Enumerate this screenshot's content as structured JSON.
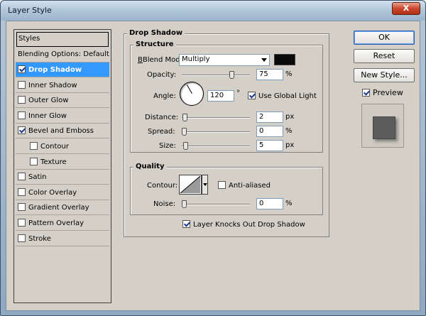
{
  "window": {
    "title": "Layer Style",
    "close": "X"
  },
  "styles": {
    "header": "Styles",
    "blending": "Blending Options: Default",
    "items": [
      {
        "label": "Drop Shadow",
        "checked": true,
        "selected": true,
        "sub": false
      },
      {
        "label": "Inner Shadow",
        "checked": false,
        "selected": false,
        "sub": false
      },
      {
        "label": "Outer Glow",
        "checked": false,
        "selected": false,
        "sub": false
      },
      {
        "label": "Inner Glow",
        "checked": false,
        "selected": false,
        "sub": false
      },
      {
        "label": "Bevel and Emboss",
        "checked": true,
        "selected": false,
        "sub": false
      },
      {
        "label": "Contour",
        "checked": false,
        "selected": false,
        "sub": true
      },
      {
        "label": "Texture",
        "checked": false,
        "selected": false,
        "sub": true
      },
      {
        "label": "Satin",
        "checked": false,
        "selected": false,
        "sub": false
      },
      {
        "label": "Color Overlay",
        "checked": false,
        "selected": false,
        "sub": false
      },
      {
        "label": "Gradient Overlay",
        "checked": false,
        "selected": false,
        "sub": false
      },
      {
        "label": "Pattern Overlay",
        "checked": false,
        "selected": false,
        "sub": false
      },
      {
        "label": "Stroke",
        "checked": false,
        "selected": false,
        "sub": false
      }
    ]
  },
  "drop_shadow": {
    "title": "Drop Shadow",
    "structure": {
      "title": "Structure",
      "blend_mode_label": "Blend Mode:",
      "blend_mode_value": "Multiply",
      "shadow_color": "#0a0a0a",
      "opacity_label": "Opacity:",
      "opacity_value": "75",
      "opacity_unit": "%",
      "angle_label": "Angle:",
      "angle_value": "120",
      "angle_unit": "°",
      "global_light_label": "Use Global Light",
      "global_light_checked": true,
      "distance_label": "Distance:",
      "distance_value": "2",
      "distance_unit": "px",
      "spread_label": "Spread:",
      "spread_value": "0",
      "spread_unit": "%",
      "size_label": "Size:",
      "size_value": "5",
      "size_unit": "px"
    },
    "quality": {
      "title": "Quality",
      "contour_label": "Contour:",
      "anti_aliased_label": "Anti-aliased",
      "anti_aliased_checked": false,
      "noise_label": "Noise:",
      "noise_value": "0",
      "noise_unit": "%"
    },
    "knockout_label": "Layer Knocks Out Drop Shadow",
    "knockout_checked": true
  },
  "buttons": {
    "ok": "OK",
    "reset": "Reset",
    "new_style": "New Style...",
    "preview_label": "Preview",
    "preview_checked": true
  }
}
